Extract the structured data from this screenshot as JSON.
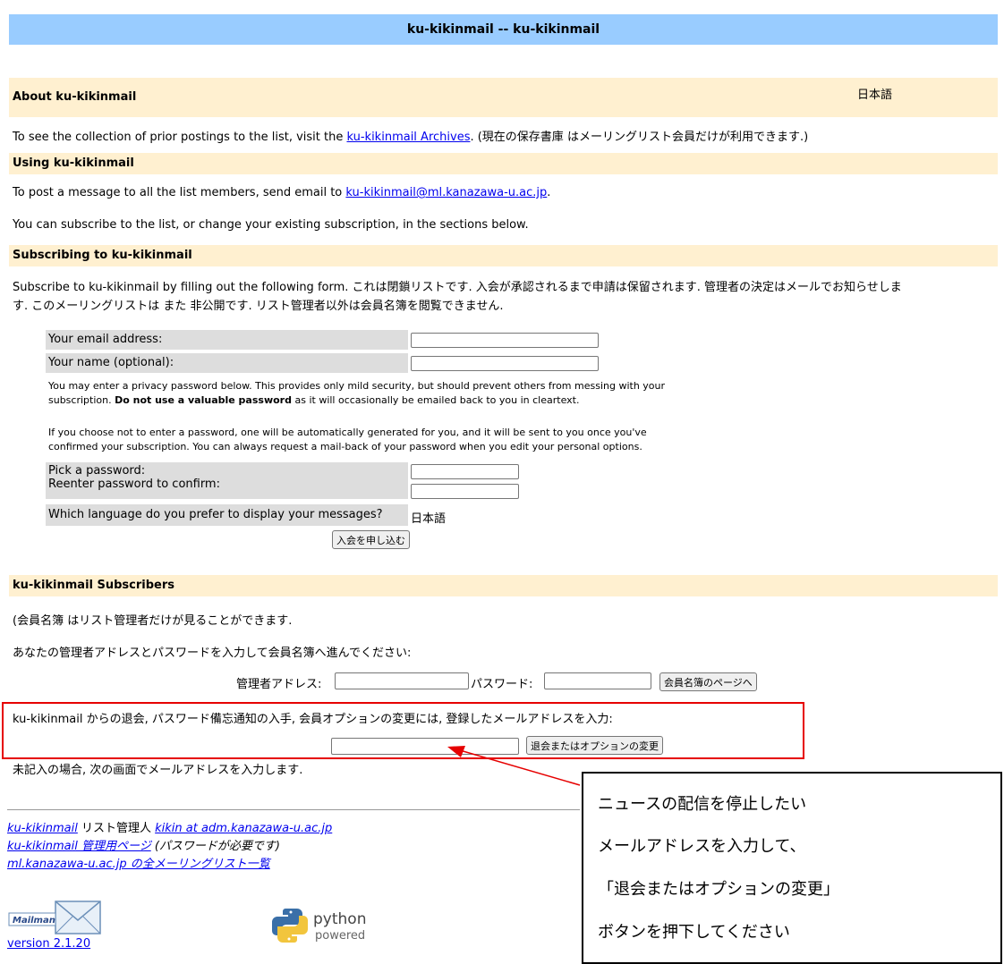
{
  "header": {
    "title": "ku-kikinmail -- ku-kikinmail"
  },
  "about": {
    "heading": "About ku-kikinmail",
    "language": "日本語",
    "archives_prefix": "To see the collection of prior postings to the list, visit the",
    "archives_link": "ku-kikinmail Archives",
    "archives_suffix": ". (現在の保存書庫 はメーリングリスト会員だけが利用できます.)"
  },
  "using": {
    "heading": "Using ku-kikinmail",
    "post_prefix": "To post a message to all the list members, send email to",
    "post_email": "ku-kikinmail@ml.kanazawa-u.ac.jp",
    "post_suffix": ".",
    "subscribe_info": "You can subscribe to the list, or change your existing subscription, in the sections below."
  },
  "subscribing": {
    "heading": "Subscribing to ku-kikinmail",
    "desc_line1": "Subscribe to ku-kikinmail by filling out the following form. これは閉鎖リストです. 入会が承認されるまで申請は保留されます. 管理者の決定はメールでお知らせしま",
    "desc_line2": "す. このメーリングリストは また 非公開です. リスト管理者以外は会員名簿を閲覧できません.",
    "email_label": "Your email address:",
    "name_label": "Your name (optional):",
    "privacy_line1": "You may enter a privacy password below. This provides only mild security, but should prevent others from messing with your",
    "privacy_line2_a": "subscription.",
    "privacy_line2_bold": "Do not use a valuable password",
    "privacy_line2_b": "as it will occasionally be emailed back to you in cleartext.",
    "auto_line1": "If you choose not to enter a password, one will be automatically generated for you, and it will be sent to you once you've",
    "auto_line2": "confirmed your subscription. You can always request a mail-back of your password when you edit your personal options.",
    "pw_label": "Pick a password:",
    "pw_confirm_label": "Reenter password to confirm:",
    "lang_label": "Which language do you prefer to display your messages?",
    "lang_value": "日本語",
    "submit_label": "入会を申し込む"
  },
  "subscribers": {
    "heading": "ku-kikinmail Subscribers",
    "roster_note": "(会員名簿 はリスト管理者だけが見ることができます.",
    "admin_prompt": "あなたの管理者アドレスとパスワードを入力して会員名簿へ進んでください:",
    "admin_addr_label": "管理者アドレス:",
    "admin_pw_label": "パスワード:",
    "roster_button": "会員名簿のページへ",
    "unsub_prompt": "ku-kikinmail からの退会, パスワード備忘通知の入手, 会員オプションの変更には, 登録したメールアドレスを入力:",
    "unsub_button": "退会またはオプションの変更",
    "blank_note": "未記入の場合, 次の画面でメールアドレスを入力します."
  },
  "footer": {
    "line1_link": "ku-kikinmail",
    "line1_text": "リスト管理人",
    "line1_admin": "kikin at adm.kanazawa-u.ac.jp",
    "line2_link": "ku-kikinmail 管理用ページ",
    "line2_text": "(パスワードが必要です)",
    "line3_link": "ml.kanazawa-u.ac.jp の全メーリングリスト一覧",
    "mailman_logo": "Mailman",
    "version": "version 2.1.20",
    "python_word": "python",
    "powered_word": "powered"
  },
  "annotation": {
    "line1": "ニュースの配信を停止したい",
    "line2": "メールアドレスを入力して、",
    "line3": "「退会またはオプションの変更」",
    "line4": "ボタンを押下してください"
  },
  "colors": {
    "title_bar": "#99ccff",
    "section": "#fff0d0",
    "highlight": "#e60000"
  }
}
